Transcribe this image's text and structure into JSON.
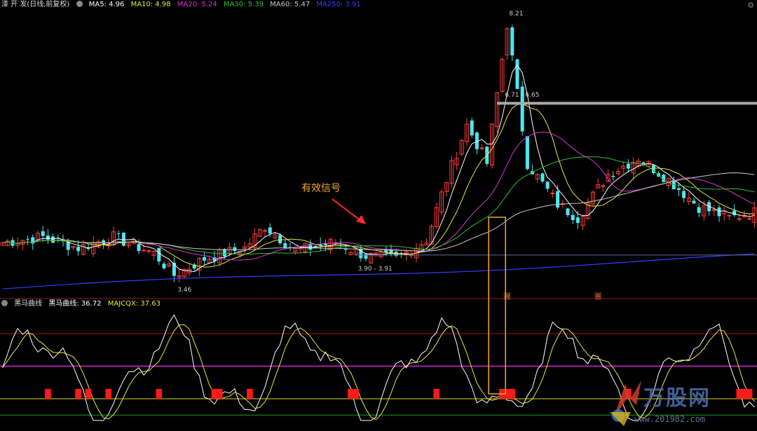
{
  "header": {
    "title": "漆 开 发(日线,前复权)",
    "ma": [
      {
        "label": "MA5: 4.96",
        "color": "#ffffff"
      },
      {
        "label": "MA10: 4.98",
        "color": "#e8e83a"
      },
      {
        "label": "MA20: 5.24",
        "color": "#d838d8"
      },
      {
        "label": "MA30: 5.39",
        "color": "#30c030"
      },
      {
        "label": "MA60: 5.47",
        "color": "#c8c8c8"
      },
      {
        "label": "MA250: 3.91",
        "color": "#3a3aff"
      }
    ]
  },
  "indicator_header": {
    "title": "黑马曲线",
    "items": [
      {
        "label": "黑马曲线: 36.72",
        "color": "#ffffff"
      },
      {
        "label": "MAJCQX: 37.63",
        "color": "#e8e83a"
      }
    ]
  },
  "annotation": {
    "text": "有效信号"
  },
  "watermark": {
    "text": "万股网",
    "url": "www.201982.com"
  },
  "chart_data": {
    "type": "candlestick",
    "title": "",
    "price_labels": {
      "high": "8.21",
      "low": "3.46",
      "range_top": "6.71 - 6.65",
      "range_mid": "3.90 - 3.91"
    },
    "event_markers": [
      "税",
      "苏"
    ],
    "colors": {
      "up": "#ff3b3b",
      "down": "#4ee6ee",
      "box": "#f2a830",
      "signal": "#ff1a1a"
    },
    "indicator_levels": {
      "upper": 80,
      "middle": 50,
      "signal": 20,
      "lower": 5
    },
    "signal_bars": [
      9,
      15,
      17,
      21,
      31,
      42,
      43,
      49,
      69,
      70,
      86,
      99,
      100,
      101,
      124,
      146,
      147,
      148
    ],
    "hlines": [
      {
        "value": 6.7,
        "color": "#aaaaaa"
      },
      {
        "value": 3.92,
        "color": "#5f6a9a"
      }
    ],
    "signal_index": 98
  }
}
